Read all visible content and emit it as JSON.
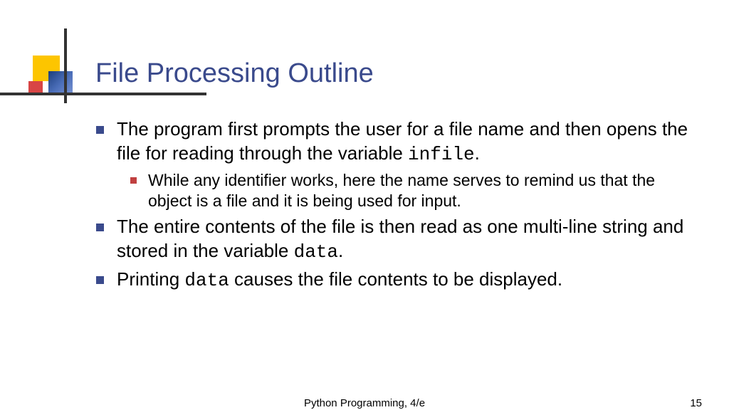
{
  "title": "File Processing Outline",
  "bullets": {
    "b1_pre": "The program first prompts the user for a file name and then opens the file for reading through the variable ",
    "b1_code": "infile",
    "b1_post": ".",
    "sub1": "While any identifier works, here the name serves to remind us that the object is a file and it is being used for input.",
    "b2_pre": "The entire contents of the file is then read as one multi-line string and stored in the variable ",
    "b2_code": "data",
    "b2_post": ".",
    "b3_pre": "Printing ",
    "b3_code": "data",
    "b3_post": " causes the file contents to be displayed."
  },
  "footer": {
    "center": "Python Programming, 4/e",
    "page": "15"
  }
}
